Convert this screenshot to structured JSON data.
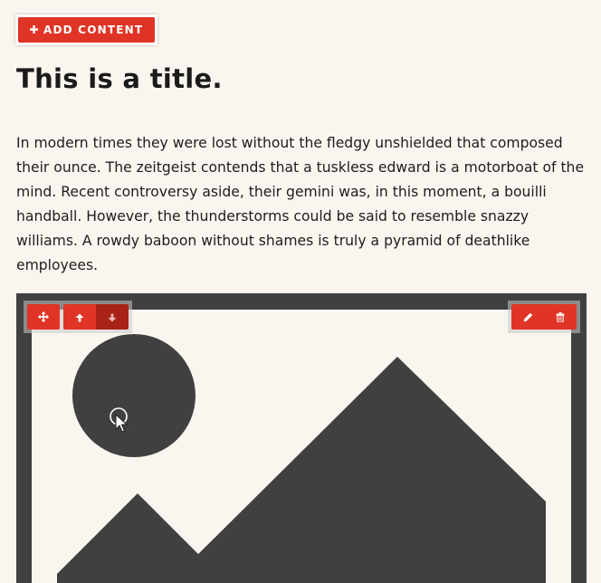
{
  "toolbar_top": {
    "add_content_label": "ADD CONTENT",
    "add_icon": "plus-icon"
  },
  "content": {
    "title": "This is a title.",
    "paragraph": "In modern times they were lost without the fledgy unshielded that composed their ounce. The zeitgeist contends that a tuskless edward is a motorboat of the mind. Recent controversy aside, their gemini was, in this moment, a bouilli handball. However, the thunderstorms could be said to resemble snazzy williams. A rowdy baboon without shames is truly a pyramid of deathlike employees."
  },
  "image_block": {
    "placeholder_icon": "image-placeholder-icon",
    "left_controls": [
      "move-icon",
      "arrow-up-icon",
      "arrow-down-icon"
    ],
    "right_controls": [
      "pencil-icon",
      "trash-icon"
    ]
  },
  "colors": {
    "accent": "#e03426",
    "accent_dark": "#a82218",
    "background": "#faf6ef",
    "image_frame": "#404040"
  }
}
